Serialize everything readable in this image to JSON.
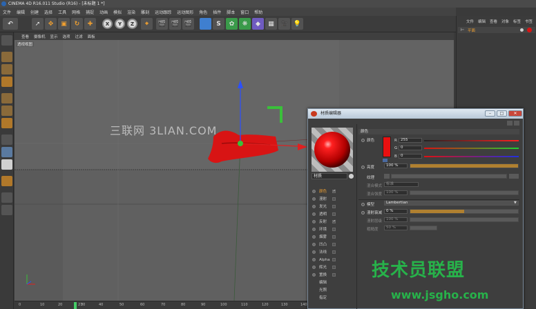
{
  "app": {
    "title": "CINEMA 4D R16.011 Studio (R16) - [未标题 1 *]"
  },
  "menubar": [
    "文件",
    "编辑",
    "创建",
    "选择",
    "工具",
    "网格",
    "捕捉",
    "动画",
    "模拟",
    "渲染",
    "雕刻",
    "运动跟踪",
    "运动图形",
    "角色",
    "插件",
    "脚本",
    "窗口",
    "帮助"
  ],
  "toolbar": {
    "axis_x": "X",
    "axis_y": "Y",
    "axis_z": "Z"
  },
  "viewport": {
    "menu": [
      "查看",
      "摄像机",
      "显示",
      "选项",
      "过滤",
      "面板"
    ],
    "label": "透视视图",
    "watermark": "三联网 3LIAN.COM"
  },
  "right_panel": {
    "menu": [
      "文件",
      "编辑",
      "查看",
      "对象",
      "标签",
      "书签"
    ],
    "item_label": "平面"
  },
  "timeline": {
    "ticks": [
      "0",
      "10",
      "20",
      "30",
      "40",
      "50",
      "60",
      "70",
      "80",
      "90",
      "100",
      "110",
      "120",
      "130",
      "140"
    ],
    "frame": "27"
  },
  "material_editor": {
    "title": "材质编辑器",
    "min": "–",
    "max": "□",
    "close": "✕",
    "material_name": "材质",
    "channels": [
      {
        "label": "颜色",
        "checked": true,
        "selected": true
      },
      {
        "label": "漫射",
        "checked": false,
        "selected": false
      },
      {
        "label": "发光",
        "checked": false,
        "selected": false
      },
      {
        "label": "透明",
        "checked": false,
        "selected": false
      },
      {
        "label": "反射",
        "checked": true,
        "selected": false
      },
      {
        "label": "环境",
        "checked": false,
        "selected": false
      },
      {
        "label": "烟雾",
        "checked": false,
        "selected": false
      },
      {
        "label": "凹凸",
        "checked": false,
        "selected": false
      },
      {
        "label": "法线",
        "checked": false,
        "selected": false
      },
      {
        "label": "Alpha",
        "checked": false,
        "selected": false
      },
      {
        "label": "辉光",
        "checked": false,
        "selected": false
      },
      {
        "label": "置换",
        "checked": false,
        "selected": false
      },
      {
        "label": "编辑",
        "checked": false,
        "selected": false
      },
      {
        "label": "光照",
        "checked": false,
        "selected": false
      },
      {
        "label": "指定",
        "checked": false,
        "selected": false
      }
    ],
    "section_title": "颜色",
    "color_label": "颜色",
    "r_label": "R",
    "g_label": "G",
    "b_label": "B",
    "r_value": "255",
    "g_value": "0",
    "b_value": "0",
    "brightness_label": "亮度",
    "brightness_value": "100 %",
    "texture_label": "纹理",
    "blend_mode_label": "混合模式",
    "blend_mode_value": "标准",
    "blend_strength_label": "混合强度",
    "blend_strength_value": "100 %",
    "model_label": "模型",
    "model_value": "Lambertian",
    "diffuse_falloff_label": "漫射衰减",
    "diffuse_falloff_value": "0 %",
    "diffuse_level_label": "漫射层级",
    "diffuse_level_value": "100 %",
    "roughness_label": "粗糙度",
    "roughness_value": "50 %",
    "colors": {
      "material": "#e81010",
      "accent": "#f0a030"
    }
  },
  "site_watermark": {
    "text": "技术员联盟",
    "url": "www.jsgho.com"
  }
}
